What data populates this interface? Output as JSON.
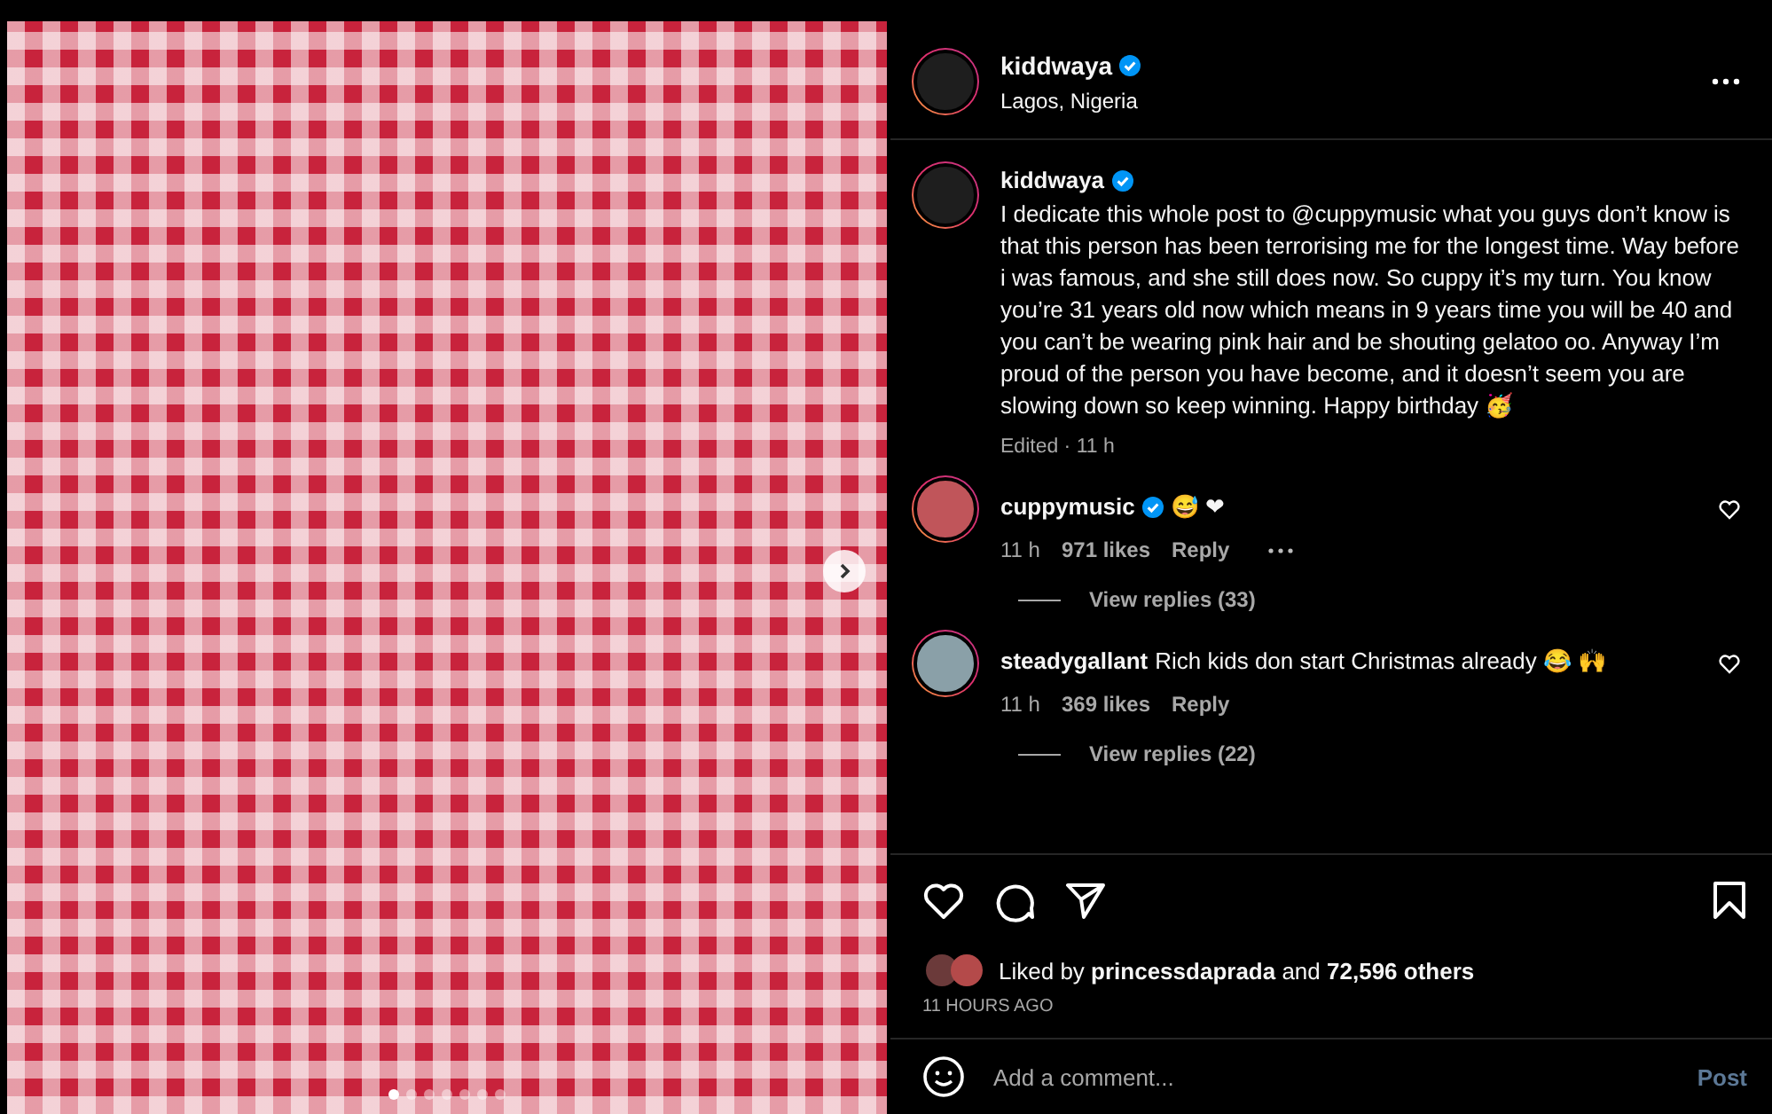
{
  "carousel": {
    "dots": [
      {
        "selected": true
      },
      {
        "selected": false
      },
      {
        "selected": false
      },
      {
        "selected": false
      },
      {
        "selected": false
      },
      {
        "selected": false
      },
      {
        "selected": false
      }
    ]
  },
  "header": {
    "username": "kiddwaya",
    "verified": true,
    "location": "Lagos, Nigeria"
  },
  "caption": {
    "username": "kiddwaya",
    "verified": true,
    "text": "I dedicate this whole post to @cuppymusic what you guys don’t know is that this person has been terrorising me for the longest time. Way before i was famous, and she still does now. So cuppy it’s my turn. You know you’re 31 years old now which means in 9 years time you will be 40 and you can’t be wearing pink hair and be shouting gelatoo oo. Anyway I’m proud of the person you have become, and it doesn’t seem you are slowing down so keep winning. Happy birthday 🥳",
    "meta": "Edited · 11 h"
  },
  "comments": [
    {
      "username": "cuppymusic",
      "verified": true,
      "text": "😅 ❤",
      "time": "11 h",
      "likes": "971 likes",
      "reply": "Reply",
      "more": true,
      "view_replies": "View replies (33)"
    },
    {
      "username": "steadygallant",
      "verified": false,
      "text": "Rich kids don start Christmas already 😂 🙌",
      "time": "11 h",
      "likes": "369 likes",
      "reply": "Reply",
      "more": false,
      "view_replies": "View replies (22)"
    }
  ],
  "likes": {
    "text": "Liked by **princessdaprada** and **72,596 others**",
    "time": "11 HOURS AGO"
  },
  "comment_box": {
    "placeholder": "Add a comment...",
    "post": "Post"
  }
}
